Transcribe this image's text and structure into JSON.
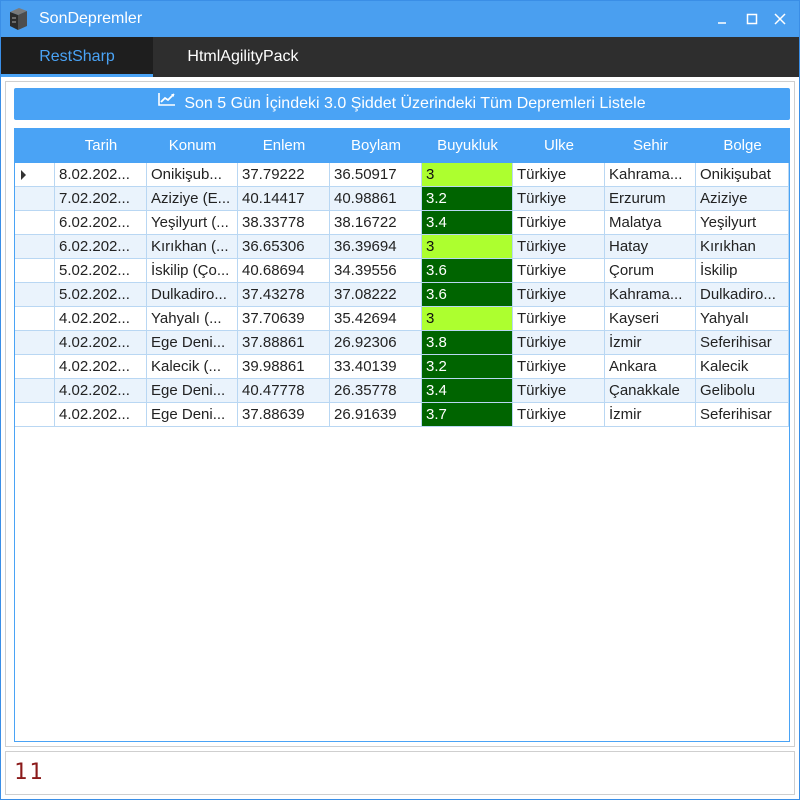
{
  "window": {
    "title": "SonDepremler",
    "minimize_label": "–",
    "close_label": "✕"
  },
  "tabs": [
    {
      "label": "RestSharp",
      "active": true
    },
    {
      "label": "HtmlAgilityPack",
      "active": false
    }
  ],
  "list_button": {
    "label": "Son 5 Gün İçindeki 3.0 Şiddet Üzerindeki Tüm Depremleri Listele",
    "icon": "line-chart-icon"
  },
  "grid": {
    "columns": [
      "Tarih",
      "Konum",
      "Enlem",
      "Boylam",
      "Buyukluk",
      "Ulke",
      "Sehir",
      "Bolge"
    ],
    "rows": [
      [
        "8.02.202...",
        "Onikişub...",
        "37.79222",
        "36.50917",
        "3",
        "Türkiye",
        "Kahrama...",
        "Onikişubat"
      ],
      [
        "7.02.202...",
        "Aziziye (E...",
        "40.14417",
        "40.98861",
        "3.2",
        "Türkiye",
        "Erzurum",
        "Aziziye"
      ],
      [
        "6.02.202...",
        "Yeşilyurt (...",
        "38.33778",
        "38.16722",
        "3.4",
        "Türkiye",
        "Malatya",
        "Yeşilyurt"
      ],
      [
        "6.02.202...",
        "Kırıkhan (...",
        "36.65306",
        "36.39694",
        "3",
        "Türkiye",
        "Hatay",
        "Kırıkhan"
      ],
      [
        "5.02.202...",
        "İskilip (Ço...",
        "40.68694",
        "34.39556",
        "3.6",
        "Türkiye",
        "Çorum",
        "İskilip"
      ],
      [
        "5.02.202...",
        "Dulkadiro...",
        "37.43278",
        "37.08222",
        "3.6",
        "Türkiye",
        "Kahrama...",
        "Dulkadiro..."
      ],
      [
        "4.02.202...",
        "Yahyalı (...",
        "37.70639",
        "35.42694",
        "3",
        "Türkiye",
        "Kayseri",
        "Yahyalı"
      ],
      [
        "4.02.202...",
        "Ege Deni...",
        "37.88861",
        "26.92306",
        "3.8",
        "Türkiye",
        "İzmir",
        "Seferihisar"
      ],
      [
        "4.02.202...",
        "Kalecik (...",
        "39.98861",
        "33.40139",
        "3.2",
        "Türkiye",
        "Ankara",
        "Kalecik"
      ],
      [
        "4.02.202...",
        "Ege Deni...",
        "40.47778",
        "26.35778",
        "3.4",
        "Türkiye",
        "Çanakkale",
        "Gelibolu"
      ],
      [
        "4.02.202...",
        "Ege Deni...",
        "37.88639",
        "26.91639",
        "3.7",
        "Türkiye",
        "İzmir",
        "Seferihisar"
      ]
    ],
    "selected_row": 0,
    "colors": {
      "header": "#4aa3f5",
      "magnitude_low": "#adff2f",
      "magnitude_high": "#006400"
    }
  },
  "status": {
    "text": "11"
  }
}
